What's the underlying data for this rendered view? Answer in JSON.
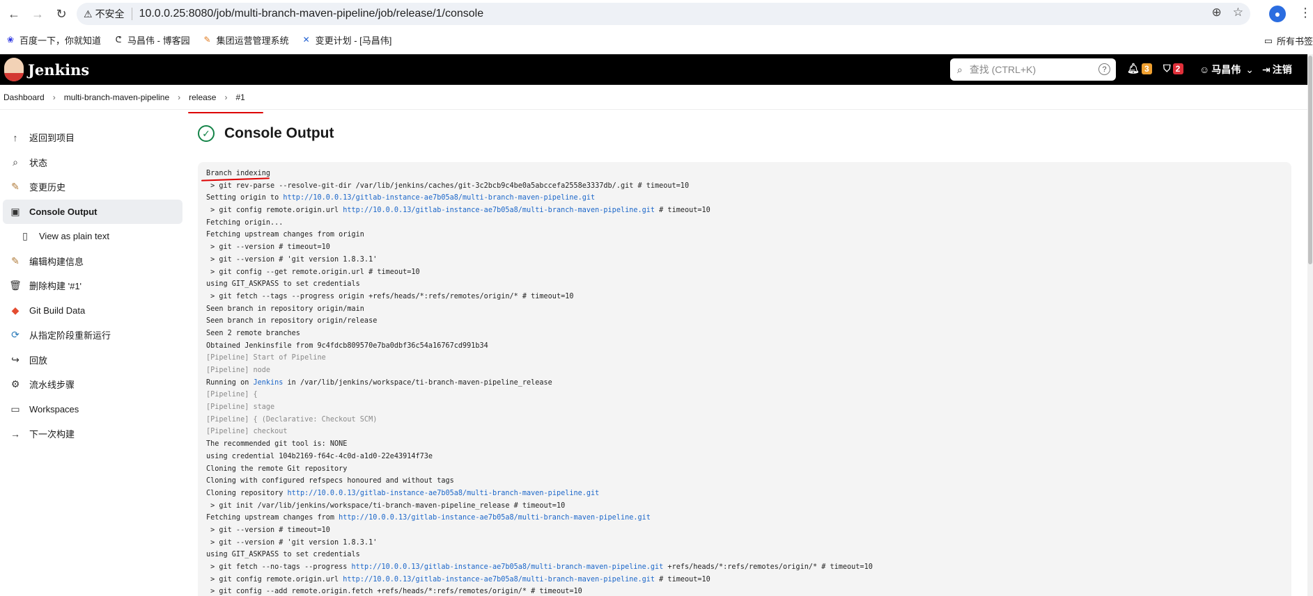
{
  "browser": {
    "insecure_label": "不安全",
    "url": "10.0.0.25:8080/job/multi-branch-maven-pipeline/job/release/1/console",
    "bookmarks": [
      "百度一下，你就知道",
      "马昌伟 - 博客园",
      "集团运营管理系统",
      "变更计划 - [马昌伟]"
    ],
    "all_bookmarks": "所有书签"
  },
  "header": {
    "brand": "Jenkins",
    "search_placeholder": "查找 (CTRL+K)",
    "notifications_count": "3",
    "security_count": "2",
    "user": "马昌伟",
    "logout": "注销",
    "accent": "#d33833"
  },
  "breadcrumb": [
    "Dashboard",
    "multi-branch-maven-pipeline",
    "release",
    "#1"
  ],
  "sidebar": {
    "items": [
      {
        "label": "返回到项目",
        "icon": "arrow-up-icon"
      },
      {
        "label": "状态",
        "icon": "search-icon"
      },
      {
        "label": "变更历史",
        "icon": "notepad-icon"
      },
      {
        "label": "Console Output",
        "icon": "terminal-icon"
      },
      {
        "label": "View as plain text",
        "icon": "document-icon"
      },
      {
        "label": "编辑构建信息",
        "icon": "notepad-icon"
      },
      {
        "label": "删除构建 '#1'",
        "icon": "trash-icon"
      },
      {
        "label": "Git Build Data",
        "icon": "git-icon"
      },
      {
        "label": "从指定阶段重新运行",
        "icon": "refresh-icon"
      },
      {
        "label": "回放",
        "icon": "replay-icon"
      },
      {
        "label": "流水线步骤",
        "icon": "gear-icon"
      },
      {
        "label": "Workspaces",
        "icon": "folder-icon"
      },
      {
        "label": "下一次构建",
        "icon": "arrow-right-icon"
      }
    ]
  },
  "main": {
    "title": "Console Output",
    "console": [
      {
        "t": "Branch indexing"
      },
      {
        "t": " > git rev-parse --resolve-git-dir /var/lib/jenkins/caches/git-3c2bcb9c4be0a5abccefa2558e3337db/.git # timeout=10"
      },
      {
        "t": "Setting origin to ",
        "link": "http://10.0.0.13/gitlab-instance-ae7b05a8/multi-branch-maven-pipeline.git"
      },
      {
        "t": " > git config remote.origin.url ",
        "link": "http://10.0.0.13/gitlab-instance-ae7b05a8/multi-branch-maven-pipeline.git",
        "after": " # timeout=10"
      },
      {
        "t": "Fetching origin..."
      },
      {
        "t": "Fetching upstream changes from origin"
      },
      {
        "t": " > git --version # timeout=10"
      },
      {
        "t": " > git --version # 'git version 1.8.3.1'"
      },
      {
        "t": " > git config --get remote.origin.url # timeout=10"
      },
      {
        "t": "using GIT_ASKPASS to set credentials"
      },
      {
        "t": " > git fetch --tags --progress origin +refs/heads/*:refs/remotes/origin/* # timeout=10"
      },
      {
        "t": "Seen branch in repository origin/main"
      },
      {
        "t": "Seen branch in repository origin/release"
      },
      {
        "t": "Seen 2 remote branches"
      },
      {
        "t": "Obtained Jenkinsfile from 9c4fdcb809570e7ba0dbf36c54a16767cd991b34"
      },
      {
        "t": "[Pipeline] Start of Pipeline",
        "pipe": true
      },
      {
        "t": "[Pipeline] node",
        "pipe": true
      },
      {
        "t": "Running on ",
        "link": "Jenkins",
        "after": " in /var/lib/jenkins/workspace/ti-branch-maven-pipeline_release"
      },
      {
        "t": "[Pipeline] {",
        "pipe": true
      },
      {
        "t": "[Pipeline] stage",
        "pipe": true
      },
      {
        "t": "[Pipeline] { (Declarative: Checkout SCM)",
        "pipe": true
      },
      {
        "t": "[Pipeline] checkout",
        "pipe": true
      },
      {
        "t": "The recommended git tool is: NONE"
      },
      {
        "t": "using credential 104b2169-f64c-4c0d-a1d0-22e43914f73e"
      },
      {
        "t": "Cloning the remote Git repository"
      },
      {
        "t": "Cloning with configured refspecs honoured and without tags"
      },
      {
        "t": "Cloning repository ",
        "link": "http://10.0.0.13/gitlab-instance-ae7b05a8/multi-branch-maven-pipeline.git"
      },
      {
        "t": " > git init /var/lib/jenkins/workspace/ti-branch-maven-pipeline_release # timeout=10"
      },
      {
        "t": "Fetching upstream changes from ",
        "link": "http://10.0.0.13/gitlab-instance-ae7b05a8/multi-branch-maven-pipeline.git"
      },
      {
        "t": " > git --version # timeout=10"
      },
      {
        "t": " > git --version # 'git version 1.8.3.1'"
      },
      {
        "t": "using GIT_ASKPASS to set credentials"
      },
      {
        "t": " > git fetch --no-tags --progress ",
        "link": "http://10.0.0.13/gitlab-instance-ae7b05a8/multi-branch-maven-pipeline.git",
        "after": " +refs/heads/*:refs/remotes/origin/* # timeout=10"
      },
      {
        "t": " > git config remote.origin.url ",
        "link": "http://10.0.0.13/gitlab-instance-ae7b05a8/multi-branch-maven-pipeline.git",
        "after": " # timeout=10"
      },
      {
        "t": " > git config --add remote.origin.fetch +refs/heads/*:refs/remotes/origin/* # timeout=10"
      }
    ]
  }
}
